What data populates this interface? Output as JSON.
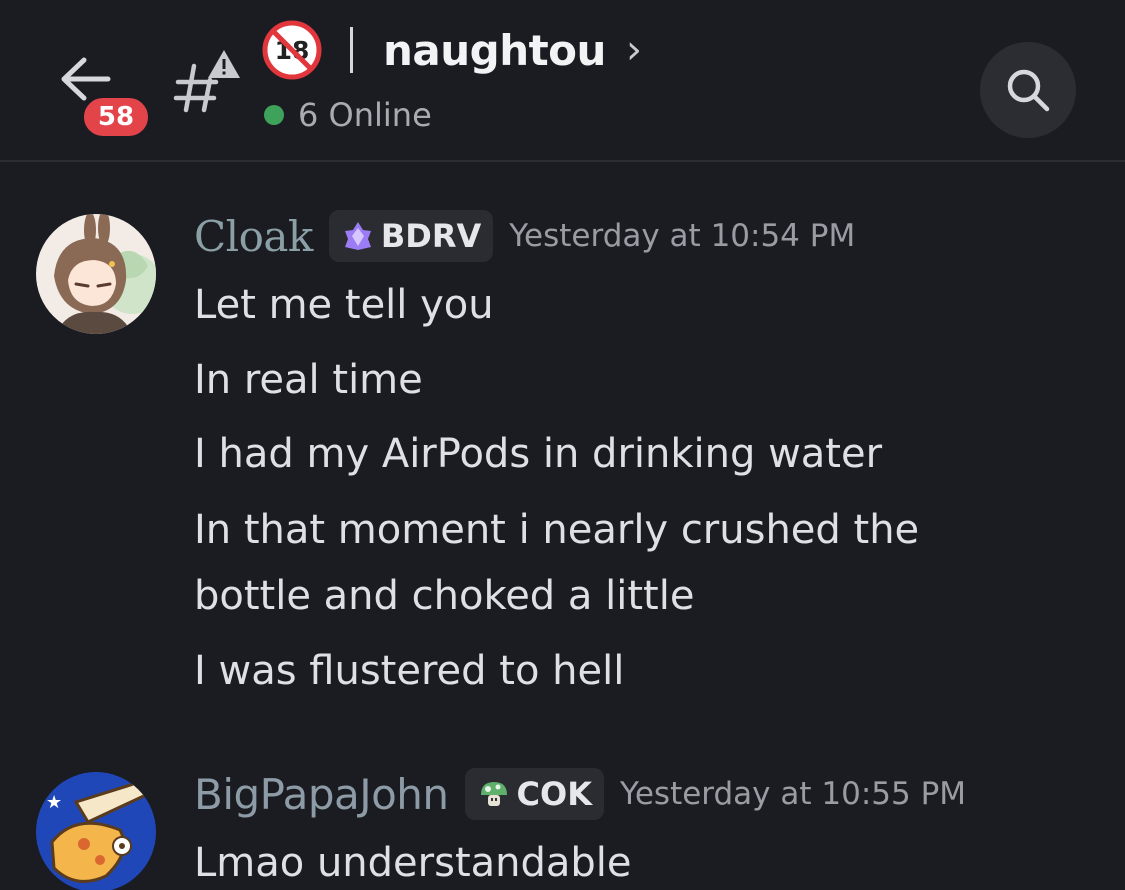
{
  "header": {
    "unread_count": "58",
    "channel_name": "naughtou",
    "chevron": "›",
    "online_text": "6 Online",
    "icons": {
      "back": "arrow-left-icon",
      "channel": "hashtag-warning-icon",
      "nsfw": "no-18-icon",
      "search": "search-icon"
    }
  },
  "messages": [
    {
      "username": "Cloak",
      "tag": "BDRV",
      "tag_icon": "purple-crystal-icon",
      "timestamp": "Yesterday at 10:54 PM",
      "lines": [
        "Let me tell you",
        "In real time",
        "I had my AirPods in drinking water",
        "In that moment i nearly crushed the",
        "bottle and choked a little",
        "I was flustered to hell"
      ]
    },
    {
      "username": "BigPapaJohn",
      "tag": "COK",
      "tag_icon": "mushroom-icon",
      "timestamp": "Yesterday at 10:55 PM",
      "lines": [
        "Lmao understandable"
      ]
    }
  ],
  "colors": {
    "background": "#1b1c21",
    "badge": "#e3444a",
    "online": "#3fa25a",
    "tag_background": "#2b2c32"
  }
}
